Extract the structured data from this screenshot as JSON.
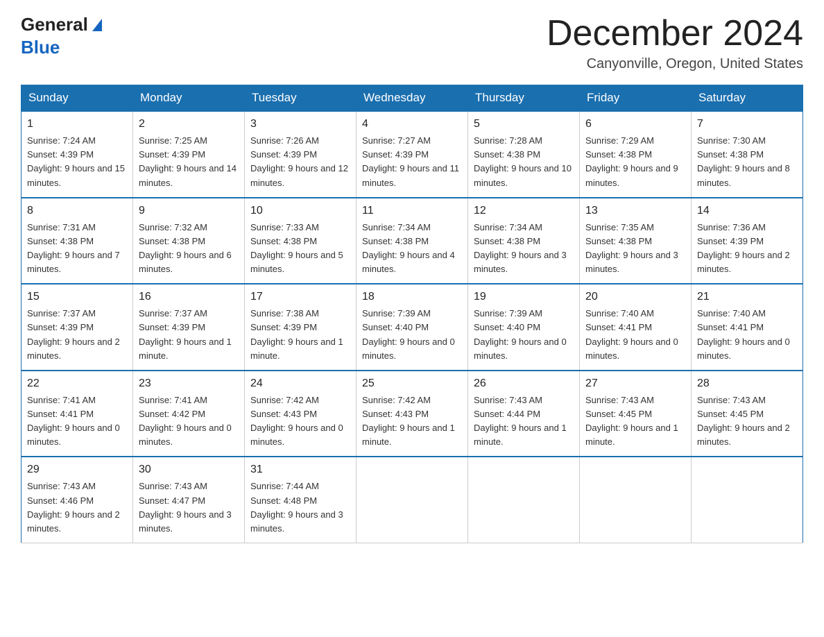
{
  "header": {
    "logo": {
      "general": "General",
      "blue": "Blue"
    },
    "title": "December 2024",
    "location": "Canyonville, Oregon, United States"
  },
  "weekdays": [
    "Sunday",
    "Monday",
    "Tuesday",
    "Wednesday",
    "Thursday",
    "Friday",
    "Saturday"
  ],
  "weeks": [
    [
      {
        "day": "1",
        "sunrise": "7:24 AM",
        "sunset": "4:39 PM",
        "daylight": "9 hours and 15 minutes."
      },
      {
        "day": "2",
        "sunrise": "7:25 AM",
        "sunset": "4:39 PM",
        "daylight": "9 hours and 14 minutes."
      },
      {
        "day": "3",
        "sunrise": "7:26 AM",
        "sunset": "4:39 PM",
        "daylight": "9 hours and 12 minutes."
      },
      {
        "day": "4",
        "sunrise": "7:27 AM",
        "sunset": "4:39 PM",
        "daylight": "9 hours and 11 minutes."
      },
      {
        "day": "5",
        "sunrise": "7:28 AM",
        "sunset": "4:38 PM",
        "daylight": "9 hours and 10 minutes."
      },
      {
        "day": "6",
        "sunrise": "7:29 AM",
        "sunset": "4:38 PM",
        "daylight": "9 hours and 9 minutes."
      },
      {
        "day": "7",
        "sunrise": "7:30 AM",
        "sunset": "4:38 PM",
        "daylight": "9 hours and 8 minutes."
      }
    ],
    [
      {
        "day": "8",
        "sunrise": "7:31 AM",
        "sunset": "4:38 PM",
        "daylight": "9 hours and 7 minutes."
      },
      {
        "day": "9",
        "sunrise": "7:32 AM",
        "sunset": "4:38 PM",
        "daylight": "9 hours and 6 minutes."
      },
      {
        "day": "10",
        "sunrise": "7:33 AM",
        "sunset": "4:38 PM",
        "daylight": "9 hours and 5 minutes."
      },
      {
        "day": "11",
        "sunrise": "7:34 AM",
        "sunset": "4:38 PM",
        "daylight": "9 hours and 4 minutes."
      },
      {
        "day": "12",
        "sunrise": "7:34 AM",
        "sunset": "4:38 PM",
        "daylight": "9 hours and 3 minutes."
      },
      {
        "day": "13",
        "sunrise": "7:35 AM",
        "sunset": "4:38 PM",
        "daylight": "9 hours and 3 minutes."
      },
      {
        "day": "14",
        "sunrise": "7:36 AM",
        "sunset": "4:39 PM",
        "daylight": "9 hours and 2 minutes."
      }
    ],
    [
      {
        "day": "15",
        "sunrise": "7:37 AM",
        "sunset": "4:39 PM",
        "daylight": "9 hours and 2 minutes."
      },
      {
        "day": "16",
        "sunrise": "7:37 AM",
        "sunset": "4:39 PM",
        "daylight": "9 hours and 1 minute."
      },
      {
        "day": "17",
        "sunrise": "7:38 AM",
        "sunset": "4:39 PM",
        "daylight": "9 hours and 1 minute."
      },
      {
        "day": "18",
        "sunrise": "7:39 AM",
        "sunset": "4:40 PM",
        "daylight": "9 hours and 0 minutes."
      },
      {
        "day": "19",
        "sunrise": "7:39 AM",
        "sunset": "4:40 PM",
        "daylight": "9 hours and 0 minutes."
      },
      {
        "day": "20",
        "sunrise": "7:40 AM",
        "sunset": "4:41 PM",
        "daylight": "9 hours and 0 minutes."
      },
      {
        "day": "21",
        "sunrise": "7:40 AM",
        "sunset": "4:41 PM",
        "daylight": "9 hours and 0 minutes."
      }
    ],
    [
      {
        "day": "22",
        "sunrise": "7:41 AM",
        "sunset": "4:41 PM",
        "daylight": "9 hours and 0 minutes."
      },
      {
        "day": "23",
        "sunrise": "7:41 AM",
        "sunset": "4:42 PM",
        "daylight": "9 hours and 0 minutes."
      },
      {
        "day": "24",
        "sunrise": "7:42 AM",
        "sunset": "4:43 PM",
        "daylight": "9 hours and 0 minutes."
      },
      {
        "day": "25",
        "sunrise": "7:42 AM",
        "sunset": "4:43 PM",
        "daylight": "9 hours and 1 minute."
      },
      {
        "day": "26",
        "sunrise": "7:43 AM",
        "sunset": "4:44 PM",
        "daylight": "9 hours and 1 minute."
      },
      {
        "day": "27",
        "sunrise": "7:43 AM",
        "sunset": "4:45 PM",
        "daylight": "9 hours and 1 minute."
      },
      {
        "day": "28",
        "sunrise": "7:43 AM",
        "sunset": "4:45 PM",
        "daylight": "9 hours and 2 minutes."
      }
    ],
    [
      {
        "day": "29",
        "sunrise": "7:43 AM",
        "sunset": "4:46 PM",
        "daylight": "9 hours and 2 minutes."
      },
      {
        "day": "30",
        "sunrise": "7:43 AM",
        "sunset": "4:47 PM",
        "daylight": "9 hours and 3 minutes."
      },
      {
        "day": "31",
        "sunrise": "7:44 AM",
        "sunset": "4:48 PM",
        "daylight": "9 hours and 3 minutes."
      },
      null,
      null,
      null,
      null
    ]
  ],
  "labels": {
    "sunrise": "Sunrise:",
    "sunset": "Sunset:",
    "daylight": "Daylight:"
  }
}
